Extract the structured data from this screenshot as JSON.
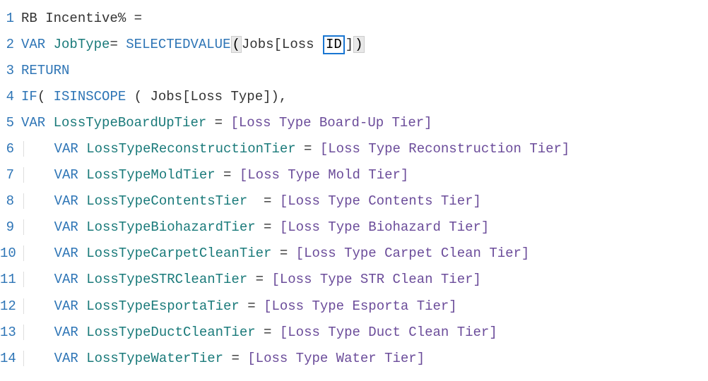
{
  "lines": [
    {
      "num": "1",
      "indent": "",
      "tokens": [
        {
          "cls": "t-measure",
          "txt": "RB Incentive% ="
        }
      ]
    },
    {
      "num": "2",
      "indent": "",
      "tokens": [
        {
          "cls": "t-keyword",
          "txt": "VAR"
        },
        {
          "cls": "t-plain",
          "txt": " "
        },
        {
          "cls": "t-var",
          "txt": "JobType"
        },
        {
          "cls": "t-op",
          "txt": "= "
        },
        {
          "cls": "t-func",
          "txt": "SELECTEDVALUE"
        },
        {
          "cls": "bracket-highlight",
          "txt": "("
        },
        {
          "cls": "t-col",
          "txt": "Jobs[Loss "
        },
        {
          "cls": "selection-box",
          "txt": "ID"
        },
        {
          "cls": "t-col",
          "txt": "]"
        },
        {
          "cls": "bracket-highlight",
          "txt": ")"
        }
      ]
    },
    {
      "num": "3",
      "indent": "",
      "tokens": [
        {
          "cls": "t-keyword",
          "txt": "RETURN"
        }
      ]
    },
    {
      "num": "4",
      "indent": "",
      "tokens": [
        {
          "cls": "t-func",
          "txt": "IF"
        },
        {
          "cls": "t-op",
          "txt": "( "
        },
        {
          "cls": "t-func",
          "txt": "ISINSCOPE"
        },
        {
          "cls": "t-op",
          "txt": " ( "
        },
        {
          "cls": "t-col",
          "txt": "Jobs[Loss Type]"
        },
        {
          "cls": "t-op",
          "txt": "),"
        }
      ]
    },
    {
      "num": "5",
      "indent": "",
      "tokens": [
        {
          "cls": "t-keyword",
          "txt": "VAR"
        },
        {
          "cls": "t-plain",
          "txt": " "
        },
        {
          "cls": "t-var",
          "txt": "LossTypeBoardUpTier"
        },
        {
          "cls": "t-op",
          "txt": " = "
        },
        {
          "cls": "t-meas",
          "txt": "[Loss Type Board-Up Tier]"
        }
      ]
    },
    {
      "num": "6",
      "indent": "    ",
      "guide": true,
      "tokens": [
        {
          "cls": "t-keyword",
          "txt": "VAR"
        },
        {
          "cls": "t-plain",
          "txt": " "
        },
        {
          "cls": "t-var",
          "txt": "LossTypeReconstructionTier"
        },
        {
          "cls": "t-op",
          "txt": " = "
        },
        {
          "cls": "t-meas",
          "txt": "[Loss Type Reconstruction Tier]"
        }
      ]
    },
    {
      "num": "7",
      "indent": "    ",
      "guide": true,
      "tokens": [
        {
          "cls": "t-keyword",
          "txt": "VAR"
        },
        {
          "cls": "t-plain",
          "txt": " "
        },
        {
          "cls": "t-var",
          "txt": "LossTypeMoldTier"
        },
        {
          "cls": "t-op",
          "txt": " = "
        },
        {
          "cls": "t-meas",
          "txt": "[Loss Type Mold Tier]"
        }
      ]
    },
    {
      "num": "8",
      "indent": "    ",
      "guide": true,
      "tokens": [
        {
          "cls": "t-keyword",
          "txt": "VAR"
        },
        {
          "cls": "t-plain",
          "txt": " "
        },
        {
          "cls": "t-var",
          "txt": "LossTypeContentsTier"
        },
        {
          "cls": "t-op",
          "txt": "  = "
        },
        {
          "cls": "t-meas",
          "txt": "[Loss Type Contents Tier]"
        }
      ]
    },
    {
      "num": "9",
      "indent": "    ",
      "guide": true,
      "tokens": [
        {
          "cls": "t-keyword",
          "txt": "VAR"
        },
        {
          "cls": "t-plain",
          "txt": " "
        },
        {
          "cls": "t-var",
          "txt": "LossTypeBiohazardTier"
        },
        {
          "cls": "t-op",
          "txt": " = "
        },
        {
          "cls": "t-meas",
          "txt": "[Loss Type Biohazard Tier]"
        }
      ]
    },
    {
      "num": "10",
      "indent": "    ",
      "guide": true,
      "tokens": [
        {
          "cls": "t-keyword",
          "txt": "VAR"
        },
        {
          "cls": "t-plain",
          "txt": " "
        },
        {
          "cls": "t-var",
          "txt": "LossTypeCarpetCleanTier"
        },
        {
          "cls": "t-op",
          "txt": " = "
        },
        {
          "cls": "t-meas",
          "txt": "[Loss Type Carpet Clean Tier]"
        }
      ]
    },
    {
      "num": "11",
      "indent": "    ",
      "guide": true,
      "tokens": [
        {
          "cls": "t-keyword",
          "txt": "VAR"
        },
        {
          "cls": "t-plain",
          "txt": " "
        },
        {
          "cls": "t-var",
          "txt": "LossTypeSTRCleanTier"
        },
        {
          "cls": "t-op",
          "txt": " = "
        },
        {
          "cls": "t-meas",
          "txt": "[Loss Type STR Clean Tier]"
        }
      ]
    },
    {
      "num": "12",
      "indent": "    ",
      "guide": true,
      "tokens": [
        {
          "cls": "t-keyword",
          "txt": "VAR"
        },
        {
          "cls": "t-plain",
          "txt": " "
        },
        {
          "cls": "t-var",
          "txt": "LossTypeEsportaTier"
        },
        {
          "cls": "t-op",
          "txt": " = "
        },
        {
          "cls": "t-meas",
          "txt": "[Loss Type Esporta Tier]"
        }
      ]
    },
    {
      "num": "13",
      "indent": "    ",
      "guide": true,
      "tokens": [
        {
          "cls": "t-keyword",
          "txt": "VAR"
        },
        {
          "cls": "t-plain",
          "txt": " "
        },
        {
          "cls": "t-var",
          "txt": "LossTypeDuctCleanTier"
        },
        {
          "cls": "t-op",
          "txt": " = "
        },
        {
          "cls": "t-meas",
          "txt": "[Loss Type Duct Clean Tier]"
        }
      ]
    },
    {
      "num": "14",
      "indent": "    ",
      "guide": true,
      "tokens": [
        {
          "cls": "t-keyword",
          "txt": "VAR"
        },
        {
          "cls": "t-plain",
          "txt": " "
        },
        {
          "cls": "t-var",
          "txt": "LossTypeWaterTier"
        },
        {
          "cls": "t-op",
          "txt": " = "
        },
        {
          "cls": "t-meas",
          "txt": "[Loss Type Water Tier]"
        }
      ]
    }
  ]
}
